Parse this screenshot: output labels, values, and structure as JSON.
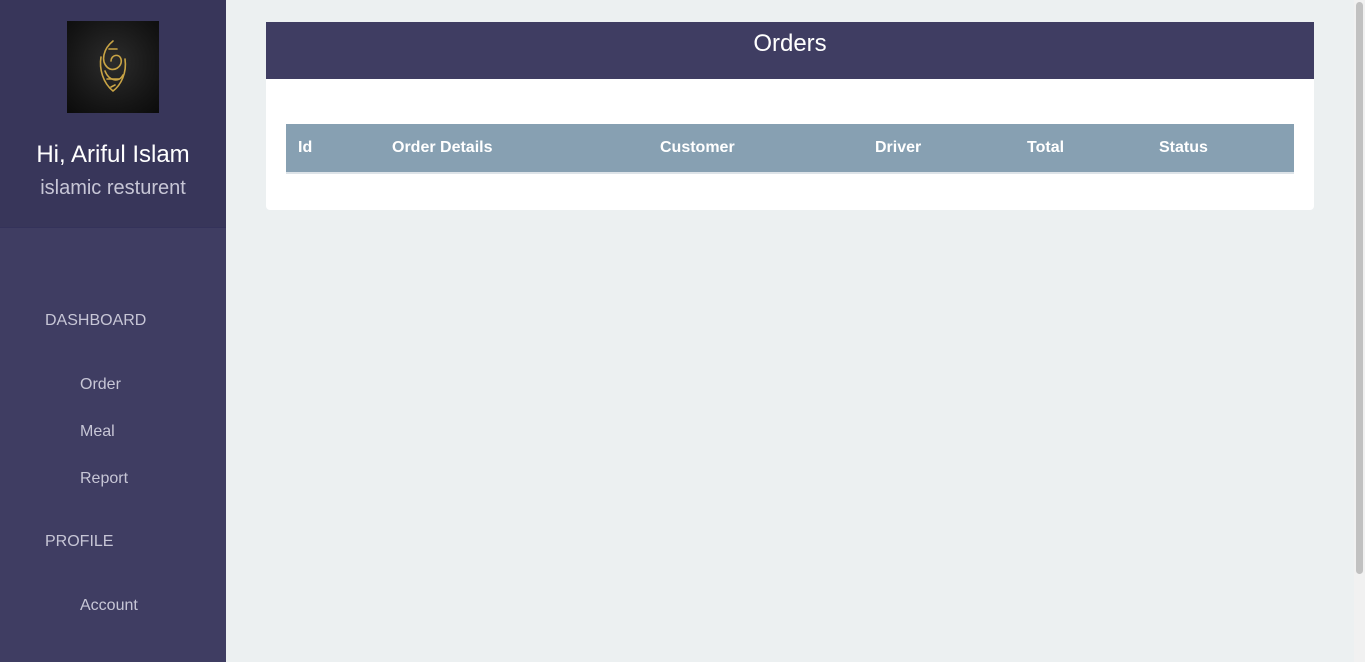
{
  "sidebar": {
    "greeting": "Hi, Ariful Islam",
    "restaurant": "islamic resturent",
    "logo_icon": "arabic-calligraphy-logo",
    "sections": [
      {
        "label": "DASHBOARD",
        "items": [
          "Order",
          "Meal",
          "Report"
        ]
      },
      {
        "label": "PROFILE",
        "items": [
          "Account"
        ]
      }
    ]
  },
  "main": {
    "title": "Orders",
    "table": {
      "columns": [
        "Id",
        "Order Details",
        "Customer",
        "Driver",
        "Total",
        "Status"
      ],
      "rows": []
    }
  },
  "colors": {
    "sidebar": "#3f3d62",
    "panel_header": "#3f3d62",
    "table_header": "#87a0b2",
    "background": "#ecf0f1"
  }
}
